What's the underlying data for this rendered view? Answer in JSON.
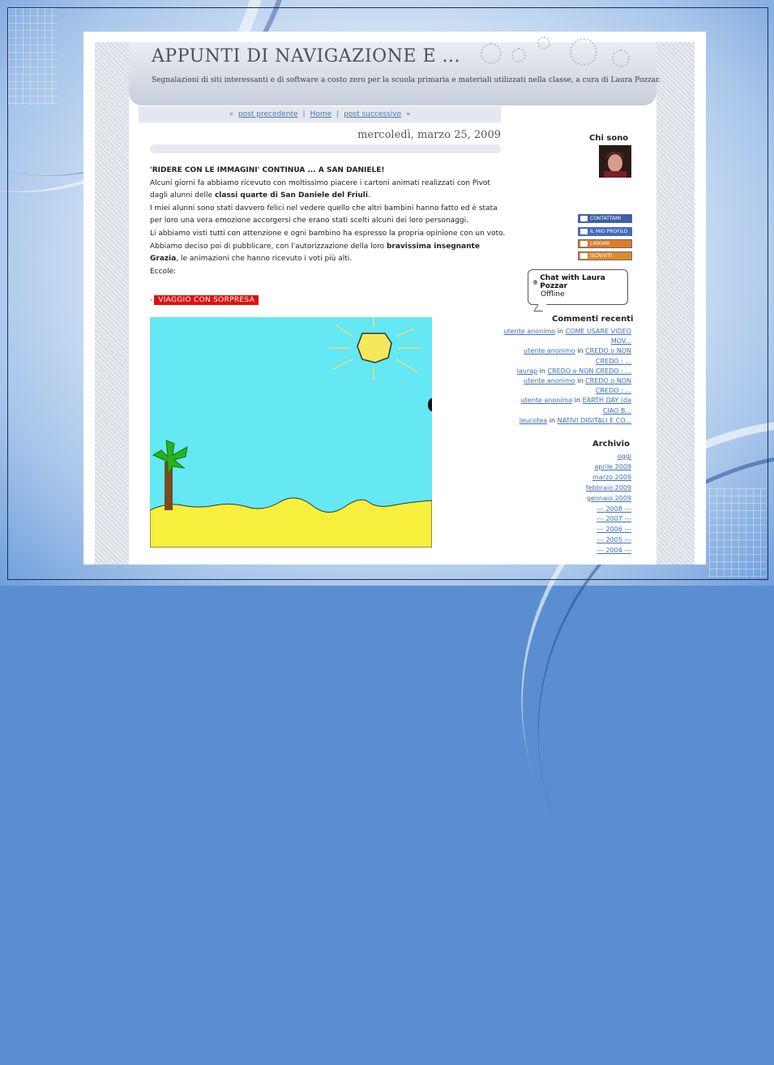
{
  "blog": {
    "title": "APPUNTI DI NAVIGAZIONE E ...",
    "description": "Segnalazioni di siti interessanti e di software a costo zero per la scuola primaria e materiali utilizzati nella classe, a cura di Laura Pozzar."
  },
  "nav": {
    "prev": "post precedente",
    "home": "Home",
    "next": "post successivo",
    "prev_arrow": "«",
    "next_arrow": "»",
    "sep": "|"
  },
  "post": {
    "date": "mercoledì, marzo 25, 2009",
    "title": "'RIDERE CON LE IMMAGINI' CONTINUA ... A SAN DANIELE!",
    "p1_a": "Alcuni giorni fa abbiamo ricevuto con moltissimo piacere i cartoni animati realizzati con Pivot dagli alunni delle ",
    "p1_b": "classi quarte di San Daniele del Friuli",
    "p1_c": ".",
    "p2": "I miei alunni sono stati davvero felici nel vedere quello che altri bambini hanno fatto ed è stata per loro una vera emozione accorgersi che erano stati scelti alcuni dei loro personaggi.",
    "p3": "Li abbiamo visti tutti con attenzione e ogni bambino ha espresso la propria opinione con un voto.",
    "p4_a": "Abbiamo deciso poi di pubblicare, con l'autorizzazione della loro ",
    "p4_b": "bravissima insegnante Grazia",
    "p4_c": ", le animazioni che hanno ricevuto i voti più alti.",
    "p5": "Eccole:",
    "link_dash": "-",
    "link_label": "VIAGGIO CON SORPRESA"
  },
  "sidebar": {
    "about_heading": "Chi sono",
    "badges": [
      {
        "label": "CONTATTAMI",
        "color": "#3b5fa8"
      },
      {
        "label": "IL MIO PROFILO",
        "color": "#3f6cc4"
      },
      {
        "label": "LINKAMI",
        "color": "#e07a24"
      },
      {
        "label": "ISCRIVITI",
        "color": "#e08a28"
      }
    ],
    "chat": {
      "name": "Chat with Laura Pozzar",
      "status": "Offline"
    },
    "comments_heading": "Commenti recenti",
    "comments": [
      {
        "who": "utente anonimo",
        "in": "in",
        "title": "COME USARE VIDEO MOV..."
      },
      {
        "who": "utente anonimo",
        "in": "in",
        "title": "CREDO o NON CREDO : ..."
      },
      {
        "who": "laurap",
        "in": "in",
        "title": "CREDO o NON CREDO : ..."
      },
      {
        "who": "utente anonimo",
        "in": "in",
        "title": "CREDO o NON CREDO : ..."
      },
      {
        "who": "utente anonimo",
        "in": "in",
        "title": "EARTH DAY (da CIAO B..."
      },
      {
        "who": "leucotea",
        "in": "in",
        "title": "NATIVI DIGITALI E CO..."
      }
    ],
    "archive_heading": "Archivio",
    "archive": [
      "oggi",
      "aprile 2009",
      "marzo 2009",
      "febbraio 2009",
      "gennaio 2009",
      "--- 2008 ---",
      "--- 2007 ---",
      "--- 2006 ---",
      "--- 2005 ---",
      "--- 2004 ---"
    ]
  },
  "colors": {
    "accent_red": "#e01010",
    "link_blue": "#3d6fb5",
    "sky": "#63e8f4",
    "sand": "#f7ef3b"
  }
}
